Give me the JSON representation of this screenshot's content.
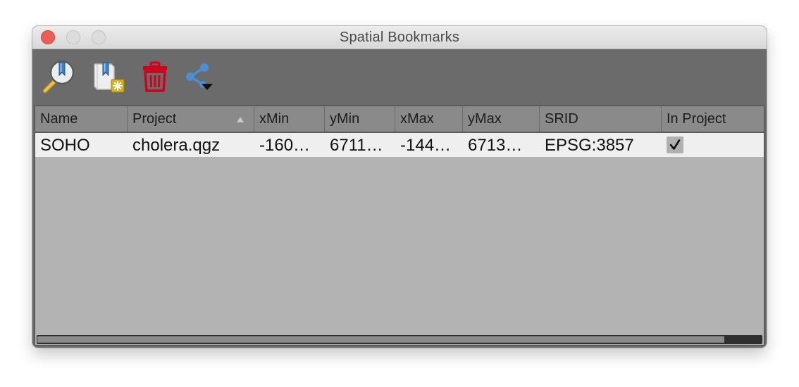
{
  "window": {
    "title": "Spatial Bookmarks"
  },
  "toolbar": {
    "tools": [
      {
        "name": "zoom-to-bookmark",
        "icon": "magnifier-bookmark-icon"
      },
      {
        "name": "new-bookmark",
        "icon": "new-bookmark-icon"
      },
      {
        "name": "delete-bookmark",
        "icon": "trash-icon"
      },
      {
        "name": "import-export",
        "icon": "share-icon"
      }
    ]
  },
  "table": {
    "columns": [
      "Name",
      "Project",
      "xMin",
      "yMin",
      "xMax",
      "yMax",
      "SRID",
      "In Project"
    ],
    "sorted_column": "Project",
    "rows": [
      {
        "name": "SOHO",
        "project": "cholera.qgz",
        "xmin": "-160…",
        "ymin": "6711…",
        "xmax": "-144…",
        "ymax": "6713…",
        "srid": "EPSG:3857",
        "in_project": true
      }
    ]
  },
  "colors": {
    "close_button": "#ec5e56",
    "toolbar_bg": "#6b6b6b",
    "table_bg": "#b3b3b3",
    "header_bg": "#8a8a8a",
    "row_bg": "#efefef",
    "trash_red": "#d0021b",
    "share_blue": "#4a8fd6"
  }
}
